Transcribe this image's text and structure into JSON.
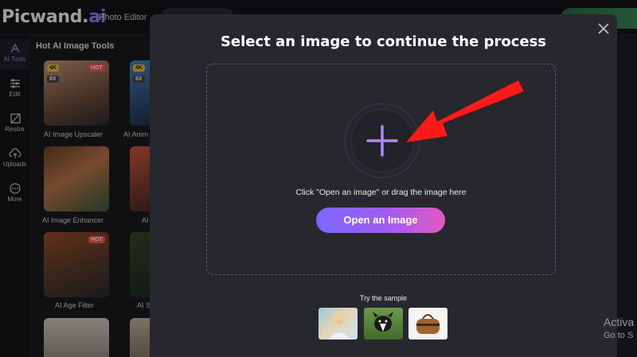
{
  "header": {
    "logo_main": "Picwand.",
    "logo_accent": "ai",
    "nav_photo_editor": "Photo Editor"
  },
  "sidebar": {
    "items": [
      {
        "label": "AI Tools",
        "icon": "ai-tools-icon"
      },
      {
        "label": "Edit",
        "icon": "sliders-icon"
      },
      {
        "label": "Resize",
        "icon": "resize-icon"
      },
      {
        "label": "Uploads",
        "icon": "upload-icon"
      },
      {
        "label": "More",
        "icon": "more-icon"
      }
    ]
  },
  "background": {
    "heading": "Hot AI Image Tools",
    "tools": [
      {
        "label": "AI Image Upscaler"
      },
      {
        "label": "AI Anim"
      },
      {
        "label": "AI Image Enhancer"
      },
      {
        "label": "AI"
      },
      {
        "label": "AI Age Filter"
      },
      {
        "label": "AI S"
      }
    ],
    "badges": {
      "hot": "HOT",
      "k4": "4K",
      "x8": "8X"
    },
    "watermark_line1": "Activa",
    "watermark_line2": "Go to S"
  },
  "modal": {
    "title": "Select an image to continue the process",
    "drop_hint": "Click \"Open an image\" or drag the image here",
    "open_button": "Open an Image",
    "sample_label": "Try the sample",
    "samples": [
      {
        "icon": "sample-woman-image"
      },
      {
        "icon": "sample-dog-image"
      },
      {
        "icon": "sample-bag-image"
      }
    ]
  },
  "colors": {
    "accent_purple": "#9e7dff",
    "button_gradient_start": "#7b67ff",
    "button_gradient_end": "#e25ac3",
    "arrow_red": "#ff1a1a"
  }
}
